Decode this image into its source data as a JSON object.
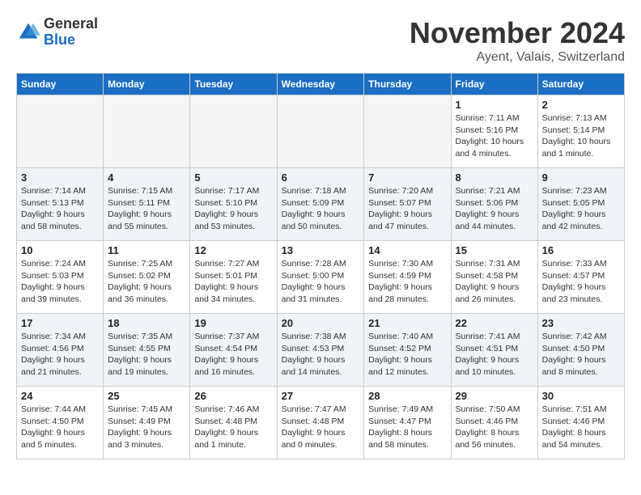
{
  "header": {
    "logo_general": "General",
    "logo_blue": "Blue",
    "month": "November 2024",
    "location": "Ayent, Valais, Switzerland"
  },
  "weekdays": [
    "Sunday",
    "Monday",
    "Tuesday",
    "Wednesday",
    "Thursday",
    "Friday",
    "Saturday"
  ],
  "weeks": [
    [
      {
        "day": "",
        "info": ""
      },
      {
        "day": "",
        "info": ""
      },
      {
        "day": "",
        "info": ""
      },
      {
        "day": "",
        "info": ""
      },
      {
        "day": "",
        "info": ""
      },
      {
        "day": "1",
        "info": "Sunrise: 7:11 AM\nSunset: 5:16 PM\nDaylight: 10 hours\nand 4 minutes."
      },
      {
        "day": "2",
        "info": "Sunrise: 7:13 AM\nSunset: 5:14 PM\nDaylight: 10 hours\nand 1 minute."
      }
    ],
    [
      {
        "day": "3",
        "info": "Sunrise: 7:14 AM\nSunset: 5:13 PM\nDaylight: 9 hours\nand 58 minutes."
      },
      {
        "day": "4",
        "info": "Sunrise: 7:15 AM\nSunset: 5:11 PM\nDaylight: 9 hours\nand 55 minutes."
      },
      {
        "day": "5",
        "info": "Sunrise: 7:17 AM\nSunset: 5:10 PM\nDaylight: 9 hours\nand 53 minutes."
      },
      {
        "day": "6",
        "info": "Sunrise: 7:18 AM\nSunset: 5:09 PM\nDaylight: 9 hours\nand 50 minutes."
      },
      {
        "day": "7",
        "info": "Sunrise: 7:20 AM\nSunset: 5:07 PM\nDaylight: 9 hours\nand 47 minutes."
      },
      {
        "day": "8",
        "info": "Sunrise: 7:21 AM\nSunset: 5:06 PM\nDaylight: 9 hours\nand 44 minutes."
      },
      {
        "day": "9",
        "info": "Sunrise: 7:23 AM\nSunset: 5:05 PM\nDaylight: 9 hours\nand 42 minutes."
      }
    ],
    [
      {
        "day": "10",
        "info": "Sunrise: 7:24 AM\nSunset: 5:03 PM\nDaylight: 9 hours\nand 39 minutes."
      },
      {
        "day": "11",
        "info": "Sunrise: 7:25 AM\nSunset: 5:02 PM\nDaylight: 9 hours\nand 36 minutes."
      },
      {
        "day": "12",
        "info": "Sunrise: 7:27 AM\nSunset: 5:01 PM\nDaylight: 9 hours\nand 34 minutes."
      },
      {
        "day": "13",
        "info": "Sunrise: 7:28 AM\nSunset: 5:00 PM\nDaylight: 9 hours\nand 31 minutes."
      },
      {
        "day": "14",
        "info": "Sunrise: 7:30 AM\nSunset: 4:59 PM\nDaylight: 9 hours\nand 28 minutes."
      },
      {
        "day": "15",
        "info": "Sunrise: 7:31 AM\nSunset: 4:58 PM\nDaylight: 9 hours\nand 26 minutes."
      },
      {
        "day": "16",
        "info": "Sunrise: 7:33 AM\nSunset: 4:57 PM\nDaylight: 9 hours\nand 23 minutes."
      }
    ],
    [
      {
        "day": "17",
        "info": "Sunrise: 7:34 AM\nSunset: 4:56 PM\nDaylight: 9 hours\nand 21 minutes."
      },
      {
        "day": "18",
        "info": "Sunrise: 7:35 AM\nSunset: 4:55 PM\nDaylight: 9 hours\nand 19 minutes."
      },
      {
        "day": "19",
        "info": "Sunrise: 7:37 AM\nSunset: 4:54 PM\nDaylight: 9 hours\nand 16 minutes."
      },
      {
        "day": "20",
        "info": "Sunrise: 7:38 AM\nSunset: 4:53 PM\nDaylight: 9 hours\nand 14 minutes."
      },
      {
        "day": "21",
        "info": "Sunrise: 7:40 AM\nSunset: 4:52 PM\nDaylight: 9 hours\nand 12 minutes."
      },
      {
        "day": "22",
        "info": "Sunrise: 7:41 AM\nSunset: 4:51 PM\nDaylight: 9 hours\nand 10 minutes."
      },
      {
        "day": "23",
        "info": "Sunrise: 7:42 AM\nSunset: 4:50 PM\nDaylight: 9 hours\nand 8 minutes."
      }
    ],
    [
      {
        "day": "24",
        "info": "Sunrise: 7:44 AM\nSunset: 4:50 PM\nDaylight: 9 hours\nand 5 minutes."
      },
      {
        "day": "25",
        "info": "Sunrise: 7:45 AM\nSunset: 4:49 PM\nDaylight: 9 hours\nand 3 minutes."
      },
      {
        "day": "26",
        "info": "Sunrise: 7:46 AM\nSunset: 4:48 PM\nDaylight: 9 hours\nand 1 minute."
      },
      {
        "day": "27",
        "info": "Sunrise: 7:47 AM\nSunset: 4:48 PM\nDaylight: 9 hours\nand 0 minutes."
      },
      {
        "day": "28",
        "info": "Sunrise: 7:49 AM\nSunset: 4:47 PM\nDaylight: 8 hours\nand 58 minutes."
      },
      {
        "day": "29",
        "info": "Sunrise: 7:50 AM\nSunset: 4:46 PM\nDaylight: 8 hours\nand 56 minutes."
      },
      {
        "day": "30",
        "info": "Sunrise: 7:51 AM\nSunset: 4:46 PM\nDaylight: 8 hours\nand 54 minutes."
      }
    ]
  ]
}
